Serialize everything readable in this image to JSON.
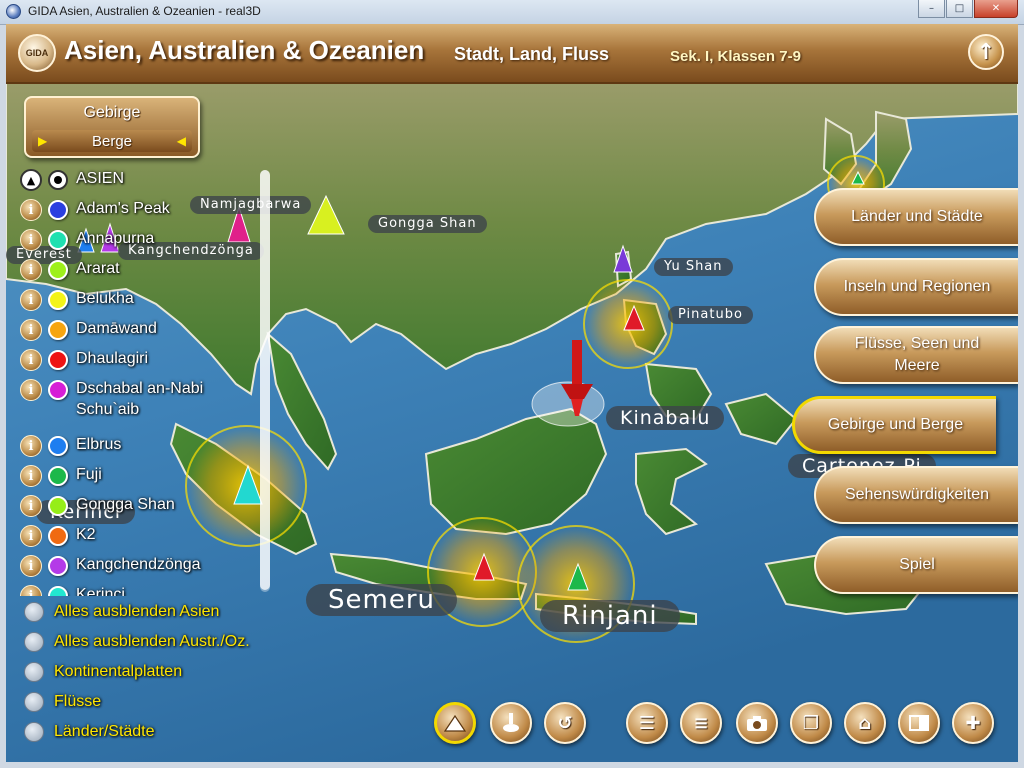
{
  "window": {
    "title": "GIDA Asien, Australien & Ozeanien - real3D",
    "minimize": "–",
    "maximize": "□",
    "close": "✕"
  },
  "header": {
    "logo": "GIDA",
    "title": "Asien, Australien & Ozeanien",
    "subtitle": "Stadt, Land, Fluss",
    "grade": "Sek. I, Klassen 7-9",
    "up_icon": "↑"
  },
  "selector": {
    "category": "Gebirge",
    "value": "Berge",
    "left_arrow": "▶",
    "right_arrow": "◀"
  },
  "list": {
    "header": "ASIEN",
    "items": [
      {
        "name": "Adam's Peak",
        "color": "#2a3fe0"
      },
      {
        "name": "Annapurna",
        "color": "#1fe0b0"
      },
      {
        "name": "Ararat",
        "color": "#9ef01a"
      },
      {
        "name": "Belukha",
        "color": "#f3f318"
      },
      {
        "name": "Damāwand",
        "color": "#f6a510"
      },
      {
        "name": "Dhaulagiri",
        "color": "#ee1313"
      },
      {
        "name": "Dschabal an-Nabi Schu`aib",
        "color": "#d61ed6"
      },
      {
        "name": "Elbrus",
        "color": "#1e7ef0"
      },
      {
        "name": "Fuji",
        "color": "#1cb84a"
      },
      {
        "name": "Gongga Shan",
        "color": "#96ee18"
      },
      {
        "name": "K2",
        "color": "#f06a12"
      },
      {
        "name": "Kangchendzönga",
        "color": "#b43ae8"
      },
      {
        "name": "Kerinci",
        "color": "#22e8d0"
      }
    ]
  },
  "toggles": [
    "Alles ausblenden Asien",
    "Alles ausblenden Austr./Oz.",
    "Kontinentalplatten",
    "Flüsse",
    "Länder/Städte"
  ],
  "menu": [
    "Länder und Städte",
    "Inseln und Regionen",
    "Flüsse, Seen und Meere",
    "Gebirge und Berge",
    "Sehenswürdigkeiten",
    "Spiel"
  ],
  "map_labels": {
    "namjagbarwa": "Namjagbarwa",
    "gongga": "Gongga Shan",
    "kangchen": "Kangchendzönga",
    "everest": "Everest",
    "yushan": "Yu Shan",
    "pinatubo": "Pinatubo",
    "kinabalu": "Kinabalu",
    "kerinci": "Kerinci",
    "semeru": "Semeru",
    "rinjani": "Rinjani",
    "cut": "Cartenez-Pi"
  },
  "toolbar_icons": [
    "mountain-icon",
    "pin-icon",
    "reset-icon",
    "list-icon",
    "list-alt-icon",
    "camera-icon",
    "copy-icon",
    "home-icon",
    "split-icon",
    "move-icon"
  ]
}
